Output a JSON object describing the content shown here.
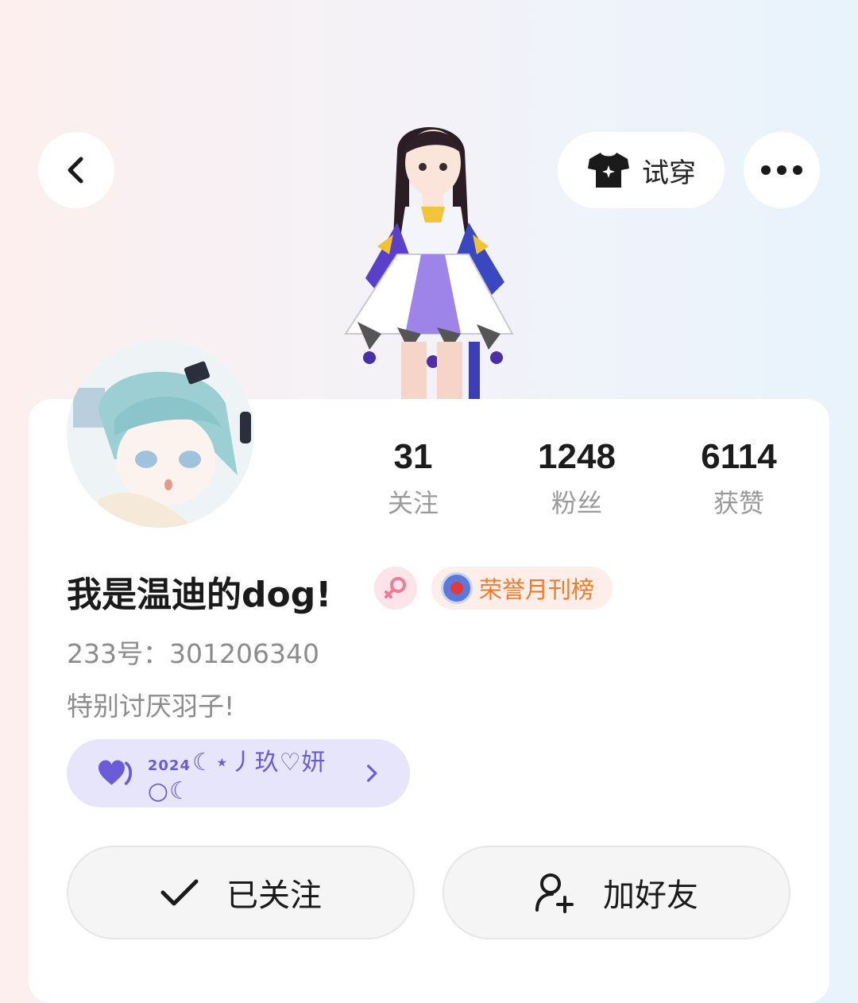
{
  "header": {
    "try_on_label": "试穿"
  },
  "stats": [
    {
      "value": "31",
      "label": "关注"
    },
    {
      "value": "1248",
      "label": "粉丝"
    },
    {
      "value": "6114",
      "label": "获赞"
    }
  ],
  "profile": {
    "name": "我是温迪的dog!",
    "honor_badge": "荣誉月刊榜",
    "uid_text": "233号：301206340",
    "bio": "特别讨厌羽子!"
  },
  "cp_tag": {
    "year": "2024",
    "text": "☾⋆丿玖♡妍○☾"
  },
  "actions": {
    "followed_label": "已关注",
    "add_friend_label": "加好友"
  },
  "colors": {
    "accent_purple": "#6c5bd8",
    "honor_orange": "#f07a2a",
    "gender_pink": "#f07c97"
  },
  "icons": [
    "back-icon",
    "shirt-icon",
    "more-icon",
    "female-icon",
    "medal-icon",
    "heart-icon",
    "chevron-right-icon",
    "check-icon",
    "add-user-icon"
  ]
}
